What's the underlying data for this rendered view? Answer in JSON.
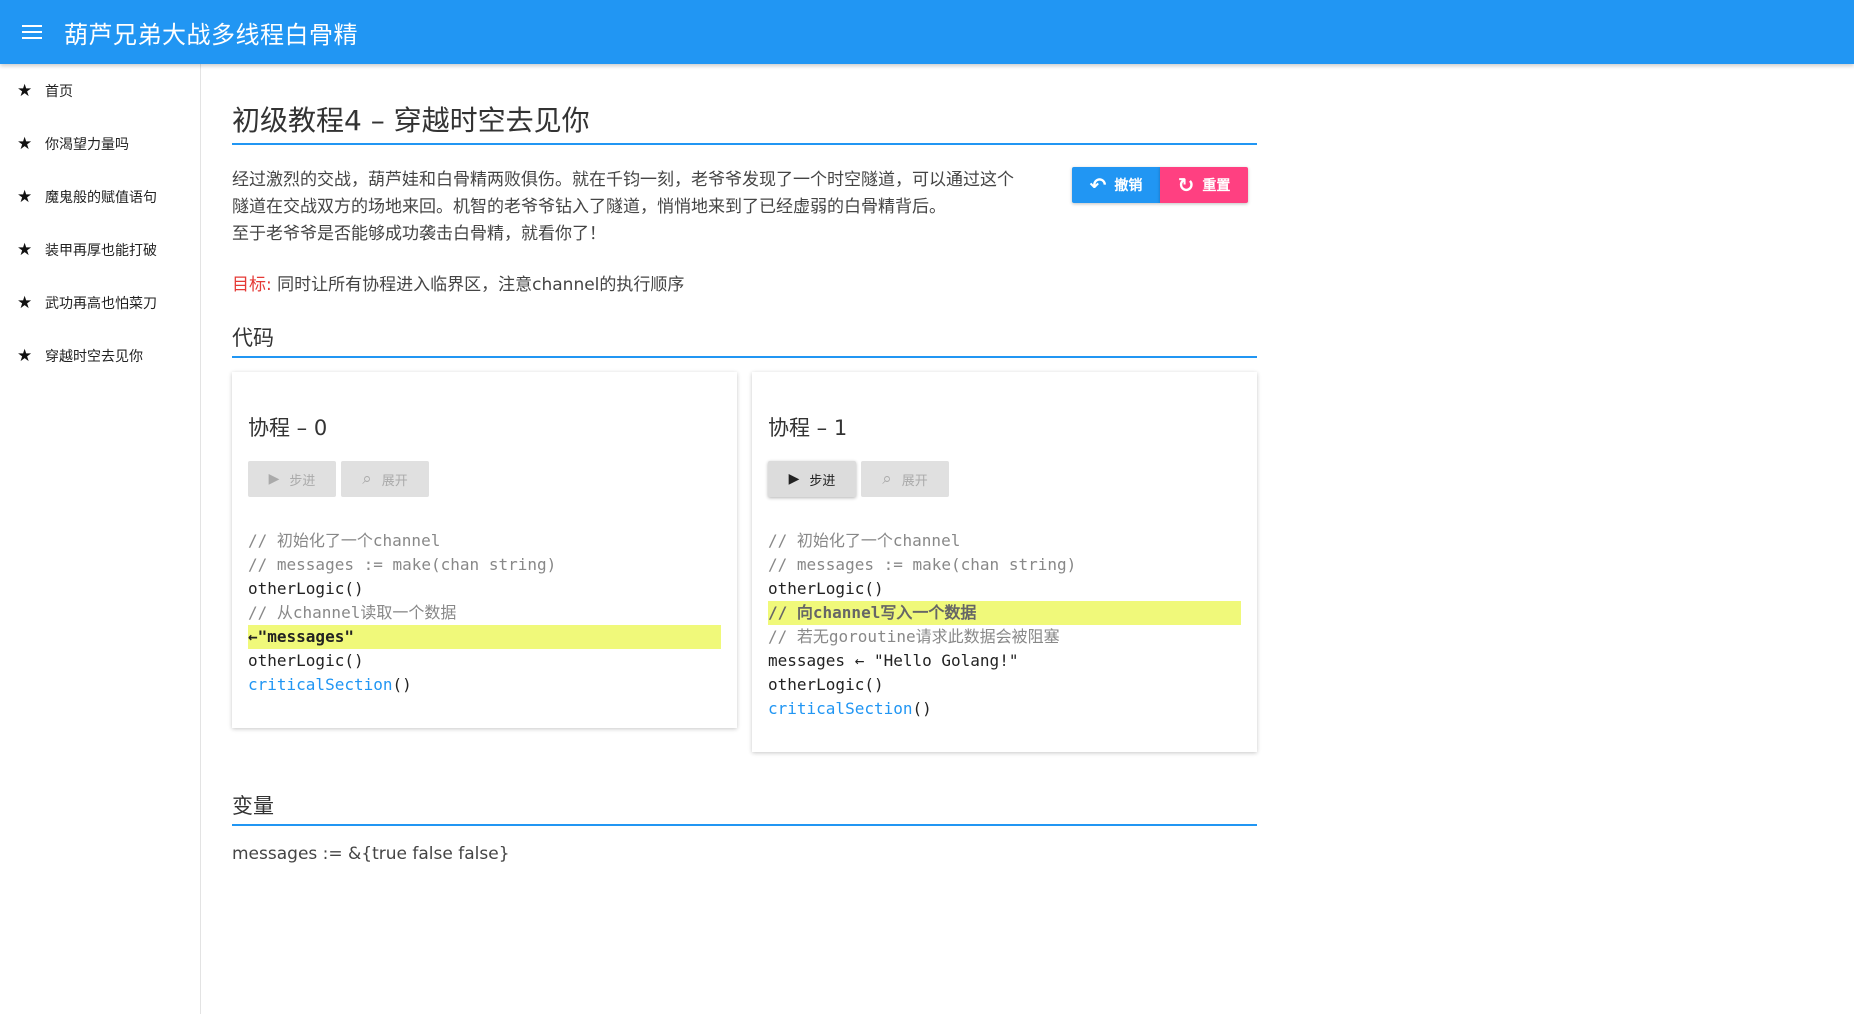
{
  "appbar": {
    "title": "葫芦兄弟大战多线程白骨精",
    "color": "#2196f3"
  },
  "sidebar": {
    "items": [
      {
        "label": "首页",
        "icon": "star-icon"
      },
      {
        "label": "你渴望力量吗",
        "icon": "star-icon"
      },
      {
        "label": "魔鬼般的赋值语句",
        "icon": "star-icon"
      },
      {
        "label": "装甲再厚也能打破",
        "icon": "star-icon"
      },
      {
        "label": "武功再高也怕菜刀",
        "icon": "star-icon"
      },
      {
        "label": "穿越时空去见你",
        "icon": "star-icon"
      }
    ]
  },
  "page": {
    "title": "初级教程4 – 穿越时空去见你",
    "intro_lines": [
      "经过激烈的交战，葫芦娃和白骨精两败俱伤。就在千钧一刻，老爷爷发现了一个时空隧道，可以通过这个",
      "隧道在交战双方的场地来回。机智的老爷爷钻入了隧道，悄悄地来到了已经虚弱的白骨精背后。",
      "至于老爷爷是否能够成功袭击白骨精，就看你了！"
    ],
    "undo_label": "撤销",
    "reset_label": "重置",
    "goal_label": "目标:",
    "goal_text": "同时让所有协程进入临界区，注意channel的执行顺序",
    "code_heading": "代码",
    "var_heading": "变量",
    "var_line": "messages := &{true false false}"
  },
  "goroutines": [
    {
      "title": "协程 – 0",
      "step_label": "步进",
      "expand_label": "展开",
      "step_enabled": false,
      "lines": [
        "// 初始化了一个channel",
        "// messages := make(chan string)",
        "otherLogic()",
        "// 从channel读取一个数据",
        "←\"messages\"",
        "otherLogic()",
        "criticalSection",
        "()"
      ]
    },
    {
      "title": "协程 – 1",
      "step_label": "步进",
      "expand_label": "展开",
      "step_enabled": true,
      "lines": [
        "// 初始化了一个channel",
        "// messages := make(chan string)",
        "otherLogic()",
        "// 向channel写入一个数据",
        "// 若无goroutine请求此数据会被阻塞",
        "messages ← \"Hello Golang!\"",
        "otherLogic()",
        "criticalSection",
        "()"
      ]
    }
  ],
  "colors": {
    "primary": "#2196f3",
    "accent": "#ff4081",
    "highlight": "#f0f97a",
    "goal": "#e53935"
  }
}
